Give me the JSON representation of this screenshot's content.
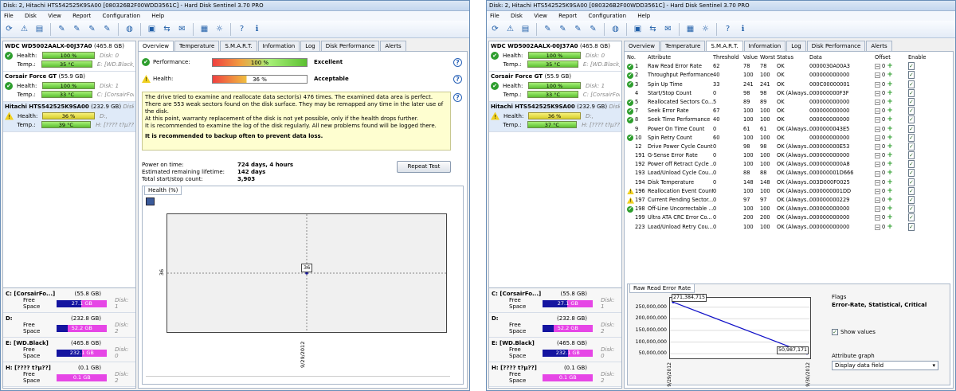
{
  "left": {
    "title": "Disk: 2, Hitachi HTS542525K9SA00 [080326B2F00WDD3561C]  -  Hard Disk Sentinel 3.70 PRO",
    "menu": [
      "File",
      "Disk",
      "View",
      "Report",
      "Configuration",
      "Help"
    ],
    "disks": [
      {
        "name": "WDC WD5002AALX-00J37A0",
        "size": "(465.8 GB)",
        "health": "100 %",
        "health_pct": 100,
        "temp": "35 °C",
        "disk": "Disk: 0",
        "drive": "E: [WD.Black]",
        "status": "ok"
      },
      {
        "name": "Corsair Force GT",
        "size": "(55.9 GB)",
        "health": "100 %",
        "health_pct": 100,
        "temp": "33 °C",
        "disk": "Disk: 1",
        "drive": "C: [CorsairFor",
        "status": "ok"
      },
      {
        "name": "Hitachi HTS542525K9SA00",
        "size": "(232.9 GB)",
        "health": "36 %",
        "health_pct": 36,
        "temp": "39 °C",
        "disk": "Disk:",
        "drive": "D:,",
        "drive2": "H: [???? t?µ??]",
        "status": "warn"
      }
    ],
    "health_label": "Health:",
    "temp_label": "Temp.:",
    "volumes": [
      {
        "name": "C: [CorsairFo...]",
        "size": "(55.8 GB)",
        "free": "27.1 GB",
        "free_pct": 49,
        "disk": "Disk: 1"
      },
      {
        "name": "D:",
        "size": "(232.8 GB)",
        "free": "52.2 GB",
        "free_pct": 22,
        "disk": "Disk: 2"
      },
      {
        "name": "E: [WD.Black]",
        "size": "(465.8 GB)",
        "free": "232.1 GB",
        "free_pct": 50,
        "disk": "Disk: 0"
      },
      {
        "name": "H: [???? t?µ??]",
        "size": "(0.1 GB)",
        "free": "0.1 GB",
        "free_pct": 0,
        "disk": "Disk: 2"
      }
    ],
    "free_space_label": "Free Space",
    "tabs": [
      "Overview",
      "Temperature",
      "S.M.A.R.T.",
      "Information",
      "Log",
      "Disk Performance",
      "Alerts"
    ],
    "performance_label": "Performance:",
    "performance_value": "100 %",
    "performance_status": "Excellent",
    "health_value": "36 %",
    "health_status": "Acceptable",
    "message": "The drive tried to examine and reallocate data sector(s) 476 times. The examined data area is perfect. There are 553 weak sectors found on the disk surface. They may be remapped any time in the later use of the disk.",
    "message2": "At this point, warranty replacement of the disk is not yet possible, only if the health drops further.",
    "message3": "It is recommended to examine the log of the disk regularly. All new problems found will be logged there.",
    "message_bold": "It is recommended to backup often to prevent data loss.",
    "power_on_label": "Power on time:",
    "power_on_value": "724 days, 4 hours",
    "lifetime_label": "Estimated remaining lifetime:",
    "lifetime_value": "142 days",
    "startstop_label": "Total start/stop count:",
    "startstop_value": "3,903",
    "repeat_test": "Repeat Test",
    "graph_tab": "Health (%)",
    "graph_point_label": "36",
    "graph_y_label": "36",
    "graph_x_label": "9/29/2012"
  },
  "right": {
    "title": "Disk: 2, Hitachi HTS542525K9SA00 [080326B2F00WDD3561C]  -  Hard Disk Sentinel 3.70 PRO",
    "menu": [
      "File",
      "Disk",
      "View",
      "Report",
      "Configuration",
      "Help"
    ],
    "disks": [
      {
        "name": "WDC WD5002AALX-00J37A0",
        "size": "(465.8 GB)",
        "health": "100 %",
        "health_pct": 100,
        "temp": "35 °C",
        "disk": "Disk: 0",
        "drive": "E: [WD.Black]",
        "status": "ok"
      },
      {
        "name": "Corsair Force GT",
        "size": "(55.9 GB)",
        "health": "100 %",
        "health_pct": 100,
        "temp": "33 °C",
        "disk": "Disk: 1",
        "drive": "C: [CorsairFor",
        "status": "ok"
      },
      {
        "name": "Hitachi HTS542525K9SA00",
        "size": "(232.9 GB)",
        "health": "36 %",
        "health_pct": 36,
        "temp": "37 °C",
        "disk": "Disk:",
        "drive": "D:,",
        "drive2": "H: [???? t?µ??]",
        "status": "warn"
      }
    ],
    "tabs": [
      "Overview",
      "Temperature",
      "S.M.A.R.T.",
      "Information",
      "Log",
      "Disk Performance",
      "Alerts"
    ],
    "smart_headers": [
      "No.",
      "Attribute",
      "Threshold",
      "Value",
      "Worst",
      "Status",
      "Data",
      "Offset",
      "Enable"
    ],
    "smart_rows": [
      {
        "st": "ok",
        "no": "1",
        "attr": "Raw Read Error Rate",
        "th": "62",
        "val": "78",
        "worst": "78",
        "status": "OK",
        "data": "0000030A00A3"
      },
      {
        "st": "ok",
        "no": "2",
        "attr": "Throughput Performance",
        "th": "40",
        "val": "100",
        "worst": "100",
        "status": "OK",
        "data": "000000000000"
      },
      {
        "st": "ok",
        "no": "3",
        "attr": "Spin Up Time",
        "th": "33",
        "val": "241",
        "worst": "241",
        "status": "OK",
        "data": "000C00000001"
      },
      {
        "st": "",
        "no": "4",
        "attr": "Start/Stop Count",
        "th": "0",
        "val": "98",
        "worst": "98",
        "status": "OK (Always...",
        "data": "000000000F3F"
      },
      {
        "st": "ok",
        "no": "5",
        "attr": "Reallocated Sectors Co...",
        "th": "5",
        "val": "89",
        "worst": "89",
        "status": "OK",
        "data": "000000000000"
      },
      {
        "st": "ok",
        "no": "7",
        "attr": "Seek Error Rate",
        "th": "67",
        "val": "100",
        "worst": "100",
        "status": "OK",
        "data": "000000000000"
      },
      {
        "st": "ok",
        "no": "8",
        "attr": "Seek Time Performance",
        "th": "40",
        "val": "100",
        "worst": "100",
        "status": "OK",
        "data": "000000000000"
      },
      {
        "st": "",
        "no": "9",
        "attr": "Power On Time Count",
        "th": "0",
        "val": "61",
        "worst": "61",
        "status": "OK (Always...",
        "data": "0000000043E5"
      },
      {
        "st": "ok",
        "no": "10",
        "attr": "Spin Retry Count",
        "th": "60",
        "val": "100",
        "worst": "100",
        "status": "OK",
        "data": "000000000000"
      },
      {
        "st": "",
        "no": "12",
        "attr": "Drive Power Cycle Count",
        "th": "0",
        "val": "98",
        "worst": "98",
        "status": "OK (Always...",
        "data": "000000000E53"
      },
      {
        "st": "",
        "no": "191",
        "attr": "G-Sense Error Rate",
        "th": "0",
        "val": "100",
        "worst": "100",
        "status": "OK (Always...",
        "data": "000000000000"
      },
      {
        "st": "",
        "no": "192",
        "attr": "Power off Retract Cycle ...",
        "th": "0",
        "val": "100",
        "worst": "100",
        "status": "OK (Always...",
        "data": "0000000000A8"
      },
      {
        "st": "",
        "no": "193",
        "attr": "Load/Unload Cycle Cou...",
        "th": "0",
        "val": "88",
        "worst": "88",
        "status": "OK (Always...",
        "data": "000000001D666"
      },
      {
        "st": "",
        "no": "194",
        "attr": "Disk Temperature",
        "th": "0",
        "val": "148",
        "worst": "148",
        "status": "OK (Always...",
        "data": "003D000F0025"
      },
      {
        "st": "warn",
        "no": "196",
        "attr": "Reallocation Event Count",
        "th": "0",
        "val": "100",
        "worst": "100",
        "status": "OK (Always...",
        "data": "0000000001DD"
      },
      {
        "st": "warn",
        "no": "197",
        "attr": "Current Pending Sector...",
        "th": "0",
        "val": "97",
        "worst": "97",
        "status": "OK (Always...",
        "data": "000000000229"
      },
      {
        "st": "ok",
        "no": "198",
        "attr": "Off-Line Uncorrectable ...",
        "th": "0",
        "val": "100",
        "worst": "100",
        "status": "OK (Always...",
        "data": "000000000000"
      },
      {
        "st": "",
        "no": "199",
        "attr": "Ultra ATA CRC Error Co...",
        "th": "0",
        "val": "200",
        "worst": "200",
        "status": "OK (Always...",
        "data": "000000000000"
      },
      {
        "st": "",
        "no": "223",
        "attr": "Load/Unload Retry Cou...",
        "th": "0",
        "val": "100",
        "worst": "100",
        "status": "OK (Always...",
        "data": "000000000000"
      }
    ],
    "offset_value": "0",
    "graph_tab": "Raw Read Error Rate",
    "flags_label": "Flags",
    "flags_value": "Error-Rate, Statistical, Critical",
    "show_values": "Show values",
    "attr_graph_label": "Attribute graph",
    "attr_graph_value": "Display data field"
  },
  "chart_data": [
    {
      "type": "line",
      "title": "Health (%)",
      "x": [
        "9/29/2012"
      ],
      "series": [
        {
          "values": [
            36
          ]
        }
      ],
      "point_labels": [
        "36"
      ],
      "ylabel": "36"
    },
    {
      "type": "line",
      "title": "Raw Read Error Rate",
      "x": [
        "9/29/2012",
        "9/30/2012"
      ],
      "series": [
        {
          "values": [
            271384715,
            50987171
          ]
        }
      ],
      "point_labels": [
        "271,384,715",
        "50,987,171"
      ],
      "yticks": [
        "250,000,000",
        "200,000,000",
        "150,000,000",
        "100,000,000",
        "50,000,000"
      ],
      "ytick_values": [
        250000000,
        200000000,
        150000000,
        100000000,
        50000000
      ],
      "ylim": [
        30000000,
        290000000
      ]
    }
  ]
}
